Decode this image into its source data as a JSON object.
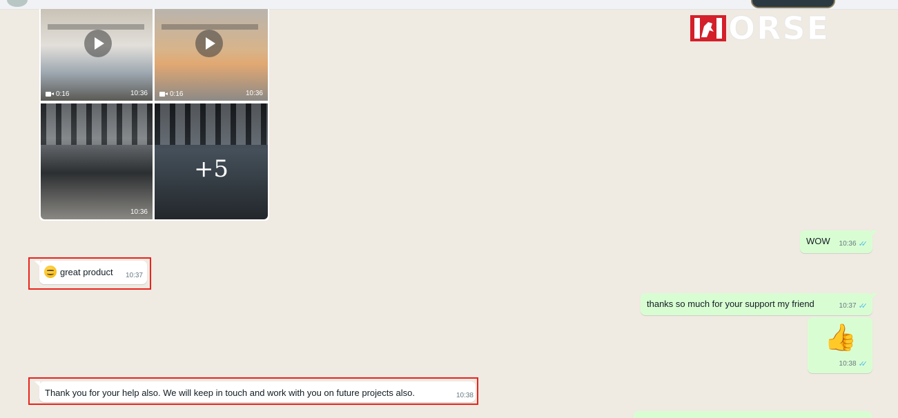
{
  "logo": {
    "text": "HORSE"
  },
  "media": {
    "items": [
      {
        "kind": "video",
        "duration": "0:16",
        "time": "10:36"
      },
      {
        "kind": "video",
        "duration": "0:16",
        "time": "10:36"
      },
      {
        "kind": "image",
        "time": "10:36"
      },
      {
        "kind": "image",
        "overlay": "+5"
      }
    ]
  },
  "messages": [
    {
      "direction": "out",
      "text": "WOW",
      "time": "10:36",
      "status": "read"
    },
    {
      "direction": "in",
      "emoji": "smiling-face",
      "text": "great product",
      "time": "10:37",
      "highlighted": true
    },
    {
      "direction": "out",
      "text": "thanks so much for your support my friend",
      "time": "10:37",
      "status": "read"
    },
    {
      "direction": "out",
      "emoji": "👍",
      "time": "10:38",
      "status": "read"
    },
    {
      "direction": "in",
      "text": "Thank you for your help also. We will keep in touch and work with you on future projects also.",
      "time": "10:38",
      "highlighted": true
    }
  ],
  "colors": {
    "chat_bg": "#efeae2",
    "incoming": "#ffffff",
    "outgoing": "#d9fdd3",
    "read_ticks": "#53bdeb",
    "highlight": "#e8231c",
    "logo_red": "#d3202a"
  }
}
